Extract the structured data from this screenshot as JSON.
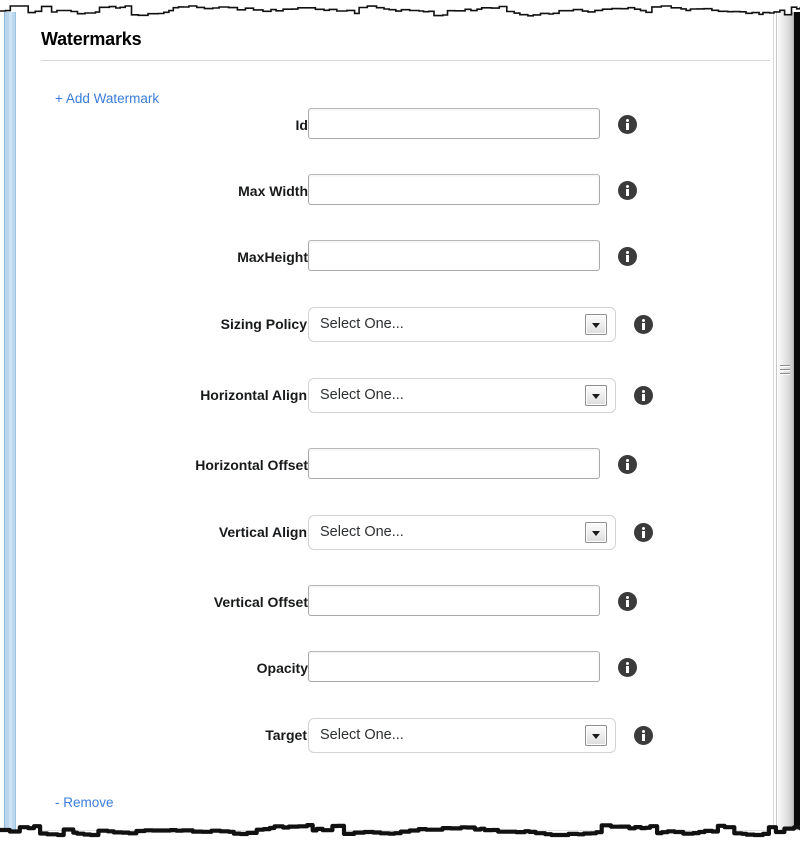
{
  "panel": {
    "title": "Watermarks",
    "add_link": "+ Add Watermark",
    "remove_link": "- Remove"
  },
  "colors": {
    "link": "#3b7dd8",
    "label_text": "#18191a",
    "input_border": "#a9a9a9",
    "select_border": "#d3d3d3",
    "rule": "#d7d7d7",
    "info_icon_bg": "#3b3b3b",
    "left_rail": "#b9d6ec",
    "scrollbar_track": "#e6e6e6"
  },
  "select_placeholder": "Select One...",
  "fields": [
    {
      "label": "Id",
      "type": "text",
      "value": "",
      "info_icon": "info-icon"
    },
    {
      "label": "Max Width",
      "type": "text",
      "value": "",
      "info_icon": "info-icon"
    },
    {
      "label": "MaxHeight",
      "type": "text",
      "value": "",
      "info_icon": "info-icon"
    },
    {
      "label": "Sizing Policy",
      "type": "select",
      "value": "Select One...",
      "info_icon": "info-icon"
    },
    {
      "label": "Horizontal Align",
      "type": "select",
      "value": "Select One...",
      "info_icon": "info-icon"
    },
    {
      "label": "Horizontal Offset",
      "type": "text",
      "value": "",
      "info_icon": "info-icon"
    },
    {
      "label": "Vertical Align",
      "type": "select",
      "value": "Select One...",
      "info_icon": "info-icon"
    },
    {
      "label": "Vertical Offset",
      "type": "text",
      "value": "",
      "info_icon": "info-icon"
    },
    {
      "label": "Opacity",
      "type": "text",
      "value": "",
      "info_icon": "info-icon"
    },
    {
      "label": "Target",
      "type": "select",
      "value": "Select One...",
      "info_icon": "info-icon"
    }
  ],
  "scrollbar": {
    "grip_icon": "grip-lines-icon"
  }
}
